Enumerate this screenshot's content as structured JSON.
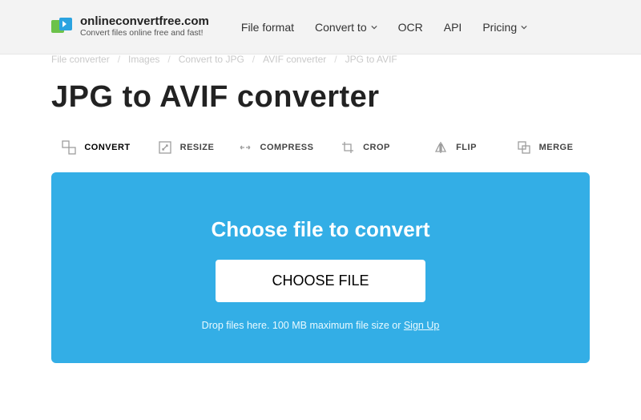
{
  "logo": {
    "title": "onlineconvertfree.com",
    "subtitle": "Convert files online free and fast!"
  },
  "nav": {
    "file_format": "File format",
    "convert_to": "Convert to",
    "ocr": "OCR",
    "api": "API",
    "pricing": "Pricing"
  },
  "breadcrumb": {
    "items": [
      "File converter",
      "Images",
      "Convert to JPG",
      "AVIF converter",
      "JPG to AVIF"
    ]
  },
  "page_title": "JPG to AVIF converter",
  "toolbar": {
    "convert": "CONVERT",
    "resize": "RESIZE",
    "compress": "COMPRESS",
    "crop": "CROP",
    "flip": "FLIP",
    "merge": "MERGE"
  },
  "upload": {
    "heading": "Choose file to convert",
    "button": "CHOOSE FILE",
    "hint_prefix": "Drop files here. 100 MB maximum file size or ",
    "hint_link": "Sign Up"
  }
}
